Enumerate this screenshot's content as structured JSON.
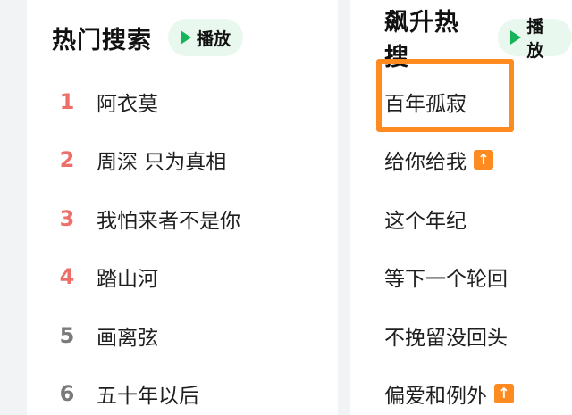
{
  "hot_search": {
    "title": "热门搜索",
    "play_label": "播放",
    "items": [
      {
        "rank": "1",
        "term": "阿衣莫"
      },
      {
        "rank": "2",
        "term": "周深 只为真相"
      },
      {
        "rank": "3",
        "term": "我怕来者不是你"
      },
      {
        "rank": "4",
        "term": "踏山河"
      },
      {
        "rank": "5",
        "term": "画离弦"
      },
      {
        "rank": "6",
        "term": "五十年以后"
      }
    ]
  },
  "rising_search": {
    "title": "飙升热搜",
    "play_label": "播放",
    "items": [
      {
        "term": "百年孤寂",
        "badge": ""
      },
      {
        "term": "给你给我",
        "badge": "up-arrow"
      },
      {
        "term": "这个年纪",
        "badge": ""
      },
      {
        "term": "等下一个轮回",
        "badge": ""
      },
      {
        "term": "不挽留没回头",
        "badge": ""
      },
      {
        "term": "偏爱和例外",
        "badge": "up-arrow"
      }
    ]
  },
  "colors": {
    "top_rank": "#ec6f6a",
    "other_rank": "#7a7a7a",
    "play_bg": "#e9f8ee",
    "play_icon": "#17b35a",
    "highlight": "#ff8a1f",
    "badge": "#ff8a1f"
  }
}
